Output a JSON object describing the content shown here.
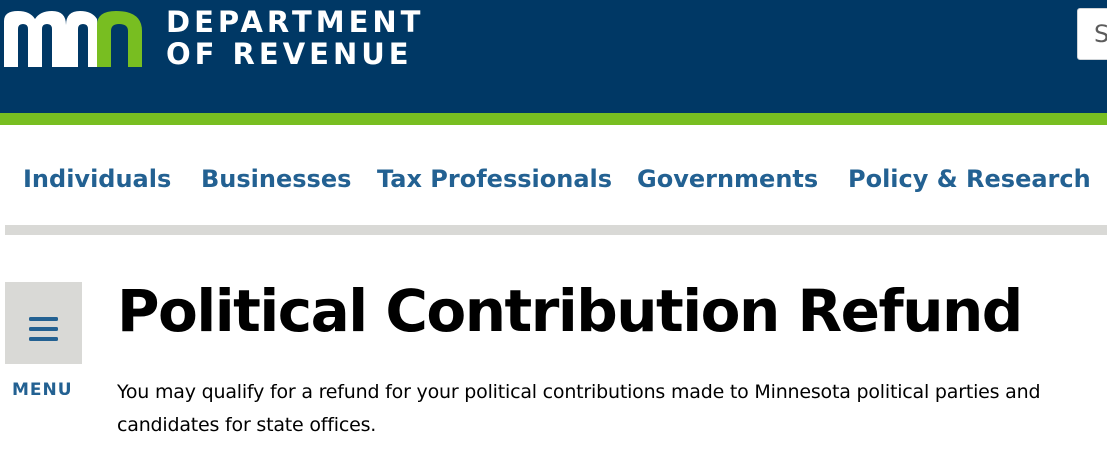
{
  "header": {
    "logo_text": "mn",
    "department_line1": "DEPARTMENT",
    "department_line2": "OF REVENUE",
    "search_partial": "S"
  },
  "nav": {
    "items": [
      {
        "label": "Individuals"
      },
      {
        "label": "Businesses"
      },
      {
        "label": "Tax Professionals"
      },
      {
        "label": "Governments"
      },
      {
        "label": "Policy & Research"
      }
    ]
  },
  "sidebar": {
    "menu_label": "MENU",
    "menu_icon": "hamburger-icon"
  },
  "main": {
    "title": "Political Contribution Refund",
    "intro": "You may qualify for a refund for your political contributions made to Minnesota political parties and candidates for state offices."
  },
  "colors": {
    "header_bg": "#003865",
    "accent_green": "#78be21",
    "nav_link": "#236192",
    "rule_gray": "#d9d9d6"
  }
}
